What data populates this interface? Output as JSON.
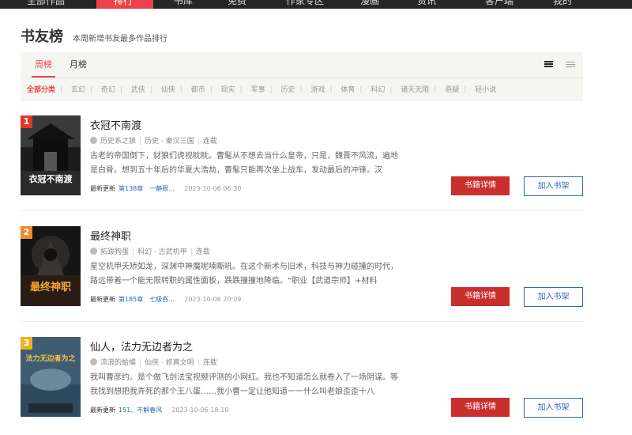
{
  "top_nav": {
    "items": [
      "全部作品",
      "排行",
      "书库",
      "免费",
      "作家专区",
      "漫画",
      "资讯",
      "客户端",
      "我的"
    ],
    "active_index": 1
  },
  "header": {
    "title": "书友榜",
    "subtitle": "本周新增书友最多作品排行"
  },
  "tabs": [
    {
      "label": "周榜",
      "active": true
    },
    {
      "label": "月榜",
      "active": false
    }
  ],
  "view_icons": [
    "list-view-icon",
    "compact-view-icon"
  ],
  "categories": [
    "全部分类",
    "玄幻",
    "奇幻",
    "武侠",
    "仙侠",
    "都市",
    "现实",
    "军事",
    "历史",
    "游戏",
    "体育",
    "科幻",
    "诸天无限",
    "悬疑",
    "轻小说"
  ],
  "actions": {
    "detail_label": "书籍详情",
    "shelf_label": "加入书架"
  },
  "books": [
    {
      "rank": "1",
      "title": "衣冠不南渡",
      "author": "历史系之狼",
      "genre": "历史",
      "subgenre": "秦汉三国",
      "status": "连载",
      "description": "古老的帝国倒下，豺狼们虎视眈眈。曹髦从不想去当什么皇帝，只是，魏晋不风流，遍地是白骨。想到五十年后的华夏大浩劫，曹髦只能再次坐上战车，发动最后的冲锋。汉",
      "latest_label": "最新更新",
      "latest_chapter": "第138章　一静眼…",
      "latest_time": "2023-10-06 06:30",
      "cover_text": "衣冠不南渡",
      "rank_color": "#E0372B"
    },
    {
      "rank": "2",
      "title": "最终神职",
      "author": "拓跋狗蛋",
      "genre": "科幻",
      "subgenre": "古武机甲",
      "status": "连载",
      "description": "星空机甲夭矫如龙，深渊中神魔呢喃嘶吼。在这个新术与旧术，科技与神力碰撞的时代，路远带着一个能无限转职的属性面板，跌跌撞撞地降临。“职业【武道宗师】+材料",
      "latest_label": "最新更新",
      "latest_chapter": "第185章　七级吞…",
      "latest_time": "2023-10-06 20:09",
      "cover_text": "最终神职",
      "rank_color": "#F08A2C"
    },
    {
      "rank": "3",
      "title": "仙人，法力无边者为之",
      "author": "流浪的蛤蟆",
      "genre": "仙侠",
      "subgenre": "修真文明",
      "status": "连载",
      "description": "我叫曹彦约。是个做飞剑法宝视频评测的小网红。我也不知道怎么就卷入了一场阴谋。等我找到想把我弄死的那个王八蛋……我小曹一定让他知道一一什么叫老娘歪歪十八",
      "latest_label": "最新更新",
      "latest_chapter": "151、不解春风",
      "latest_time": "2023-10-06 18:10",
      "cover_text": "法力无边者为之",
      "rank_color": "#E8B41E"
    }
  ]
}
